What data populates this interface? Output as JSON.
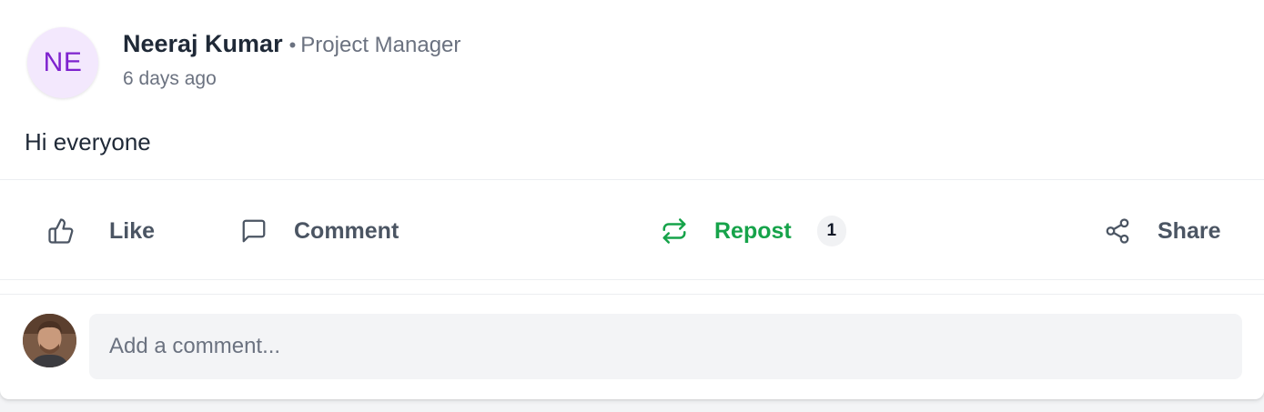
{
  "post": {
    "author": {
      "initials": "NE",
      "name": "Neeraj Kumar",
      "separator": "•",
      "role": "Project Manager"
    },
    "time": "6 days ago",
    "body": "Hi everyone"
  },
  "actions": {
    "like_label": "Like",
    "comment_label": "Comment",
    "repost_label": "Repost",
    "repost_count": "1",
    "share_label": "Share"
  },
  "composer": {
    "placeholder": "Add a comment..."
  },
  "icons": {
    "like": "thumbs-up-icon",
    "comment": "message-square-icon",
    "repost": "repeat-icon",
    "share": "share-nodes-icon"
  },
  "colors": {
    "avatar_bg": "#f3e8fd",
    "avatar_text": "#7e22ce",
    "repost_active": "#16a34a",
    "action_gray": "#4b5563"
  }
}
